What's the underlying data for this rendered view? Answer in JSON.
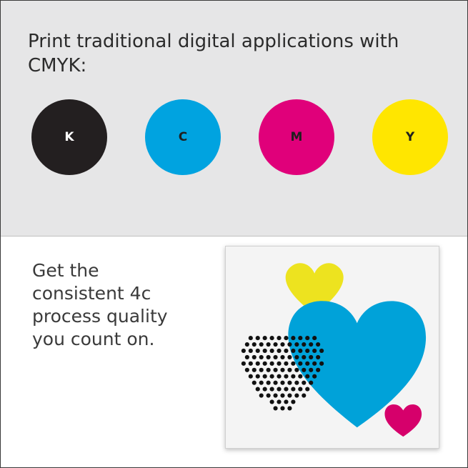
{
  "header": {
    "title": "Print traditional digital applications with CMYK:"
  },
  "inks": [
    {
      "label": "K",
      "color": "#231f20",
      "text_color": "#ffffff"
    },
    {
      "label": "C",
      "color": "#00a3e0",
      "text_color": "#1f1f1f"
    },
    {
      "label": "M",
      "color": "#e0007a",
      "text_color": "#1f1f1f"
    },
    {
      "label": "Y",
      "color": "#ffe600",
      "text_color": "#1f1f1f"
    }
  ],
  "body": {
    "text": "Get the consistent 4c process quality you count on."
  },
  "illustration": {
    "name": "cmyk-hearts-illustration",
    "colors": {
      "yellow_heart": "#ede31f",
      "cyan_heart": "#00a2d9",
      "magenta_heart": "#d6006b",
      "dots": "#111111"
    }
  }
}
